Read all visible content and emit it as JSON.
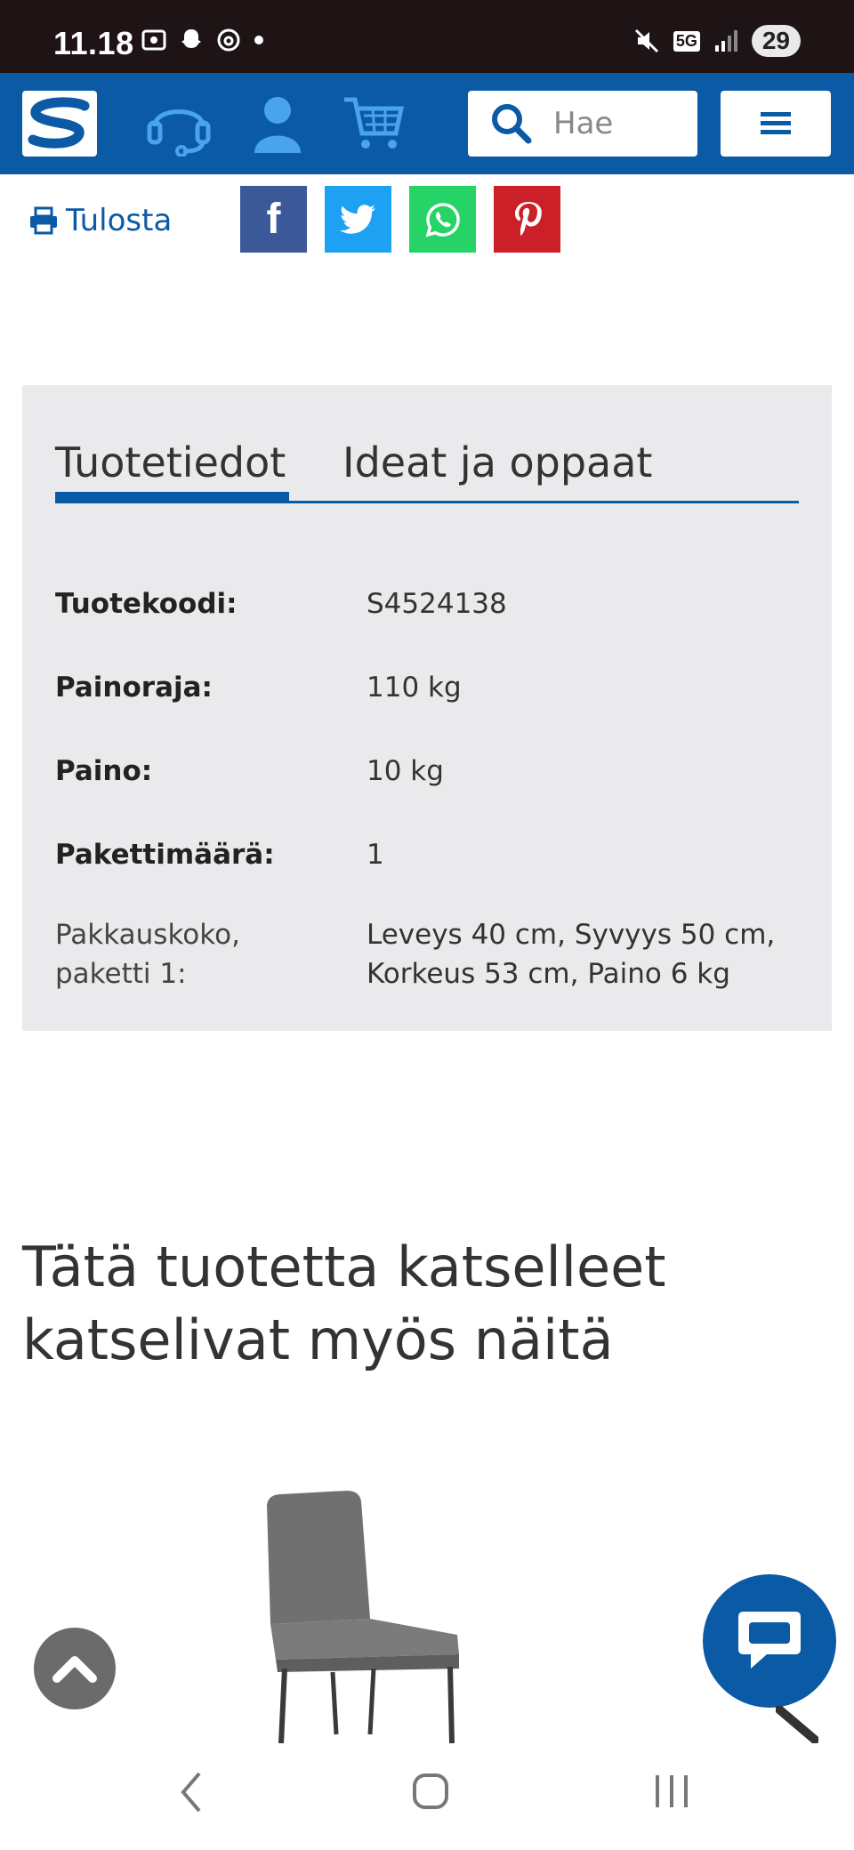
{
  "status_bar": {
    "time": "11.18",
    "battery": "29",
    "network": "5G"
  },
  "header": {
    "logo_text": "S",
    "search_placeholder": "Hae"
  },
  "share": {
    "print_label": "Tulosta",
    "facebook": "f",
    "colors": {
      "facebook": "#3b5998",
      "twitter": "#1da1f2",
      "whatsapp": "#25d366",
      "pinterest": "#cb2027"
    }
  },
  "product_info": {
    "tabs": [
      "Tuotetiedot",
      "Ideat ja oppaat"
    ],
    "rows": [
      {
        "label": "Tuotekoodi:",
        "value": "S4524138"
      },
      {
        "label": "Painoraja:",
        "value": "110 kg"
      },
      {
        "label": "Paino:",
        "value": "10 kg"
      },
      {
        "label": "Pakettimäärä:",
        "value": "1"
      }
    ],
    "package_label_1": "Pakkauskoko,",
    "package_label_2": "paketti 1:",
    "package_value_1": "Leveys 40 cm, Syvyys 50 cm,",
    "package_value_2": "Korkeus 53 cm, Paino 6 kg"
  },
  "recommendations": {
    "heading_line1": "Tätä tuotetta katselleet",
    "heading_line2": "katselivat myös näitä"
  },
  "accent_color": "#0a5aa6"
}
